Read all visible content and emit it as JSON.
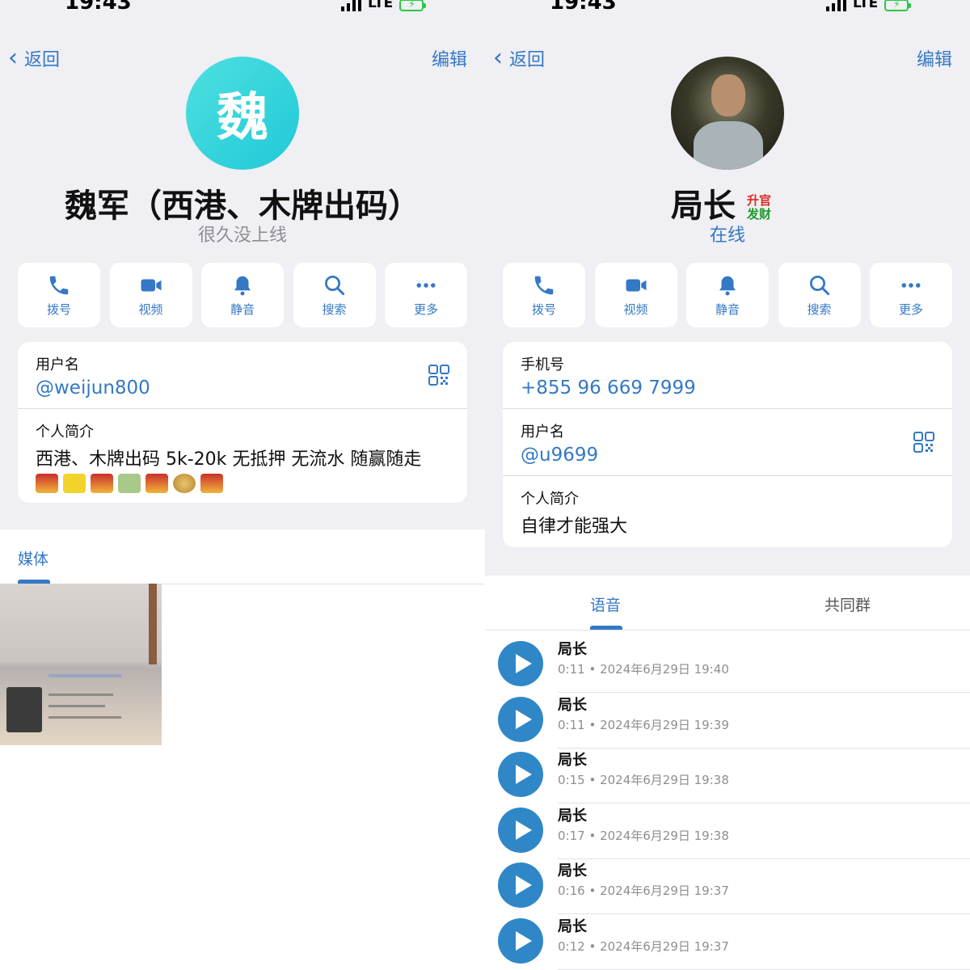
{
  "status_bar": {
    "time": "19:43",
    "network": "LTE"
  },
  "colors": {
    "accent": "#3478c6",
    "avatar_teal": "#1fc9d8",
    "play": "#2f87c7",
    "battery": "#28c940"
  },
  "left": {
    "back_label": "返回",
    "edit_label": "编辑",
    "avatar_letter": "魏",
    "name": "魏军（西港、木牌出码）",
    "status": "很久没上线",
    "actions": [
      {
        "label": "拨号",
        "icon": "phone-icon"
      },
      {
        "label": "视频",
        "icon": "video-icon"
      },
      {
        "label": "静音",
        "icon": "bell-icon"
      },
      {
        "label": "搜索",
        "icon": "search-icon"
      },
      {
        "label": "更多",
        "icon": "more-icon"
      }
    ],
    "username_label": "用户名",
    "username": "@weijun800",
    "bio_label": "个人简介",
    "bio": "西港、木牌出码 5k-20k 无抵押 无流水 随赢随走",
    "bio_emojis": [
      "slot-machine",
      "ticket",
      "slot-machine",
      "dollar-bill",
      "slot-machine",
      "money-bag",
      "slot-machine"
    ],
    "media_tab": "媒体"
  },
  "right": {
    "back_label": "返回",
    "edit_label": "编辑",
    "name": "局长",
    "badge_top": "升官",
    "badge_bottom": "发财",
    "status": "在线",
    "actions": [
      {
        "label": "拨号",
        "icon": "phone-icon"
      },
      {
        "label": "视频",
        "icon": "video-icon"
      },
      {
        "label": "静音",
        "icon": "bell-icon"
      },
      {
        "label": "搜索",
        "icon": "search-icon"
      },
      {
        "label": "更多",
        "icon": "more-icon"
      }
    ],
    "phone_label": "手机号",
    "phone": "+855 96 669 7999",
    "username_label": "用户名",
    "username": "@u9699",
    "bio_label": "个人简介",
    "bio": "自律才能强大",
    "tabs": [
      "语音",
      "共同群"
    ],
    "voice_messages": [
      {
        "title": "局长",
        "meta": "0:11 • 2024年6月29日 19:40"
      },
      {
        "title": "局长",
        "meta": "0:11 • 2024年6月29日 19:39"
      },
      {
        "title": "局长",
        "meta": "0:15 • 2024年6月29日 19:38"
      },
      {
        "title": "局长",
        "meta": "0:17 • 2024年6月29日 19:38"
      },
      {
        "title": "局长",
        "meta": "0:16 • 2024年6月29日 19:37"
      },
      {
        "title": "局长",
        "meta": "0:12 • 2024年6月29日 19:37"
      }
    ]
  }
}
